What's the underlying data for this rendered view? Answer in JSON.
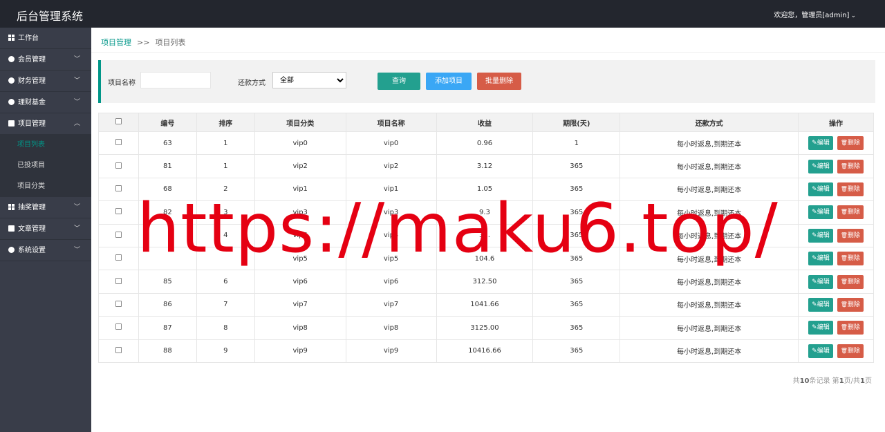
{
  "header": {
    "brand": "后台管理系统",
    "user": "欢迎您，管理员[admin]"
  },
  "sidebar": {
    "items": [
      {
        "label": "工作台"
      },
      {
        "label": "会员管理"
      },
      {
        "label": "财务管理"
      },
      {
        "label": "理财基金"
      },
      {
        "label": "项目管理"
      },
      {
        "label": "抽奖管理"
      },
      {
        "label": "文章管理"
      },
      {
        "label": "系统设置"
      }
    ],
    "sub": [
      {
        "label": "项目列表"
      },
      {
        "label": "已投项目"
      },
      {
        "label": "项目分类"
      }
    ]
  },
  "breadcrumb": {
    "parent": "项目管理",
    "sep": ">>",
    "current": "项目列表"
  },
  "search": {
    "name_label": "项目名称",
    "name_value": "",
    "method_label": "还款方式",
    "method_selected": "全部",
    "query_btn": "查询",
    "add_btn": "添加项目",
    "batch_delete_btn": "批量删除"
  },
  "table": {
    "headers": [
      "编号",
      "排序",
      "项目分类",
      "项目名称",
      "收益",
      "期限(天)",
      "还款方式",
      "操作"
    ],
    "rows": [
      {
        "id": "63",
        "sort": "1",
        "cat": "vip0",
        "name": "vip0",
        "income": "0.96",
        "term": "1",
        "method": "每小时返息,到期还本"
      },
      {
        "id": "81",
        "sort": "1",
        "cat": "vip2",
        "name": "vip2",
        "income": "3.12",
        "term": "365",
        "method": "每小时返息,到期还本"
      },
      {
        "id": "68",
        "sort": "2",
        "cat": "vip1",
        "name": "vip1",
        "income": "1.05",
        "term": "365",
        "method": "每小时返息,到期还本"
      },
      {
        "id": "82",
        "sort": "3",
        "cat": "vip3",
        "name": "vip3",
        "income": "9.3",
        "term": "365",
        "method": "每小时返息,到期还本"
      },
      {
        "id": "",
        "sort": "4",
        "cat": "vip4",
        "name": "vip4",
        "income": "31.",
        "term": "365",
        "method": "每小时返息,到期还本"
      },
      {
        "id": "",
        "sort": "",
        "cat": "vip5",
        "name": "vip5",
        "income": "104.6",
        "term": "365",
        "method": "每小时返息,到期还本"
      },
      {
        "id": "85",
        "sort": "6",
        "cat": "vip6",
        "name": "vip6",
        "income": "312.50",
        "term": "365",
        "method": "每小时返息,到期还本"
      },
      {
        "id": "86",
        "sort": "7",
        "cat": "vip7",
        "name": "vip7",
        "income": "1041.66",
        "term": "365",
        "method": "每小时返息,到期还本"
      },
      {
        "id": "87",
        "sort": "8",
        "cat": "vip8",
        "name": "vip8",
        "income": "3125.00",
        "term": "365",
        "method": "每小时返息,到期还本"
      },
      {
        "id": "88",
        "sort": "9",
        "cat": "vip9",
        "name": "vip9",
        "income": "10416.66",
        "term": "365",
        "method": "每小时返息,到期还本"
      }
    ],
    "edit_label": "编辑",
    "delete_label": "删除"
  },
  "pager": {
    "prefix": "共",
    "total": "10",
    "mid": "条记录 第",
    "page": "1",
    "mid2": "页/共",
    "pages": "1",
    "suffix": "页"
  },
  "watermark": "https://maku6.top/",
  "colors": {
    "accent": "#009688",
    "blue": "#3aa7f5",
    "red": "#d65c47",
    "header": "#23262e",
    "sidebar": "#393d49"
  }
}
